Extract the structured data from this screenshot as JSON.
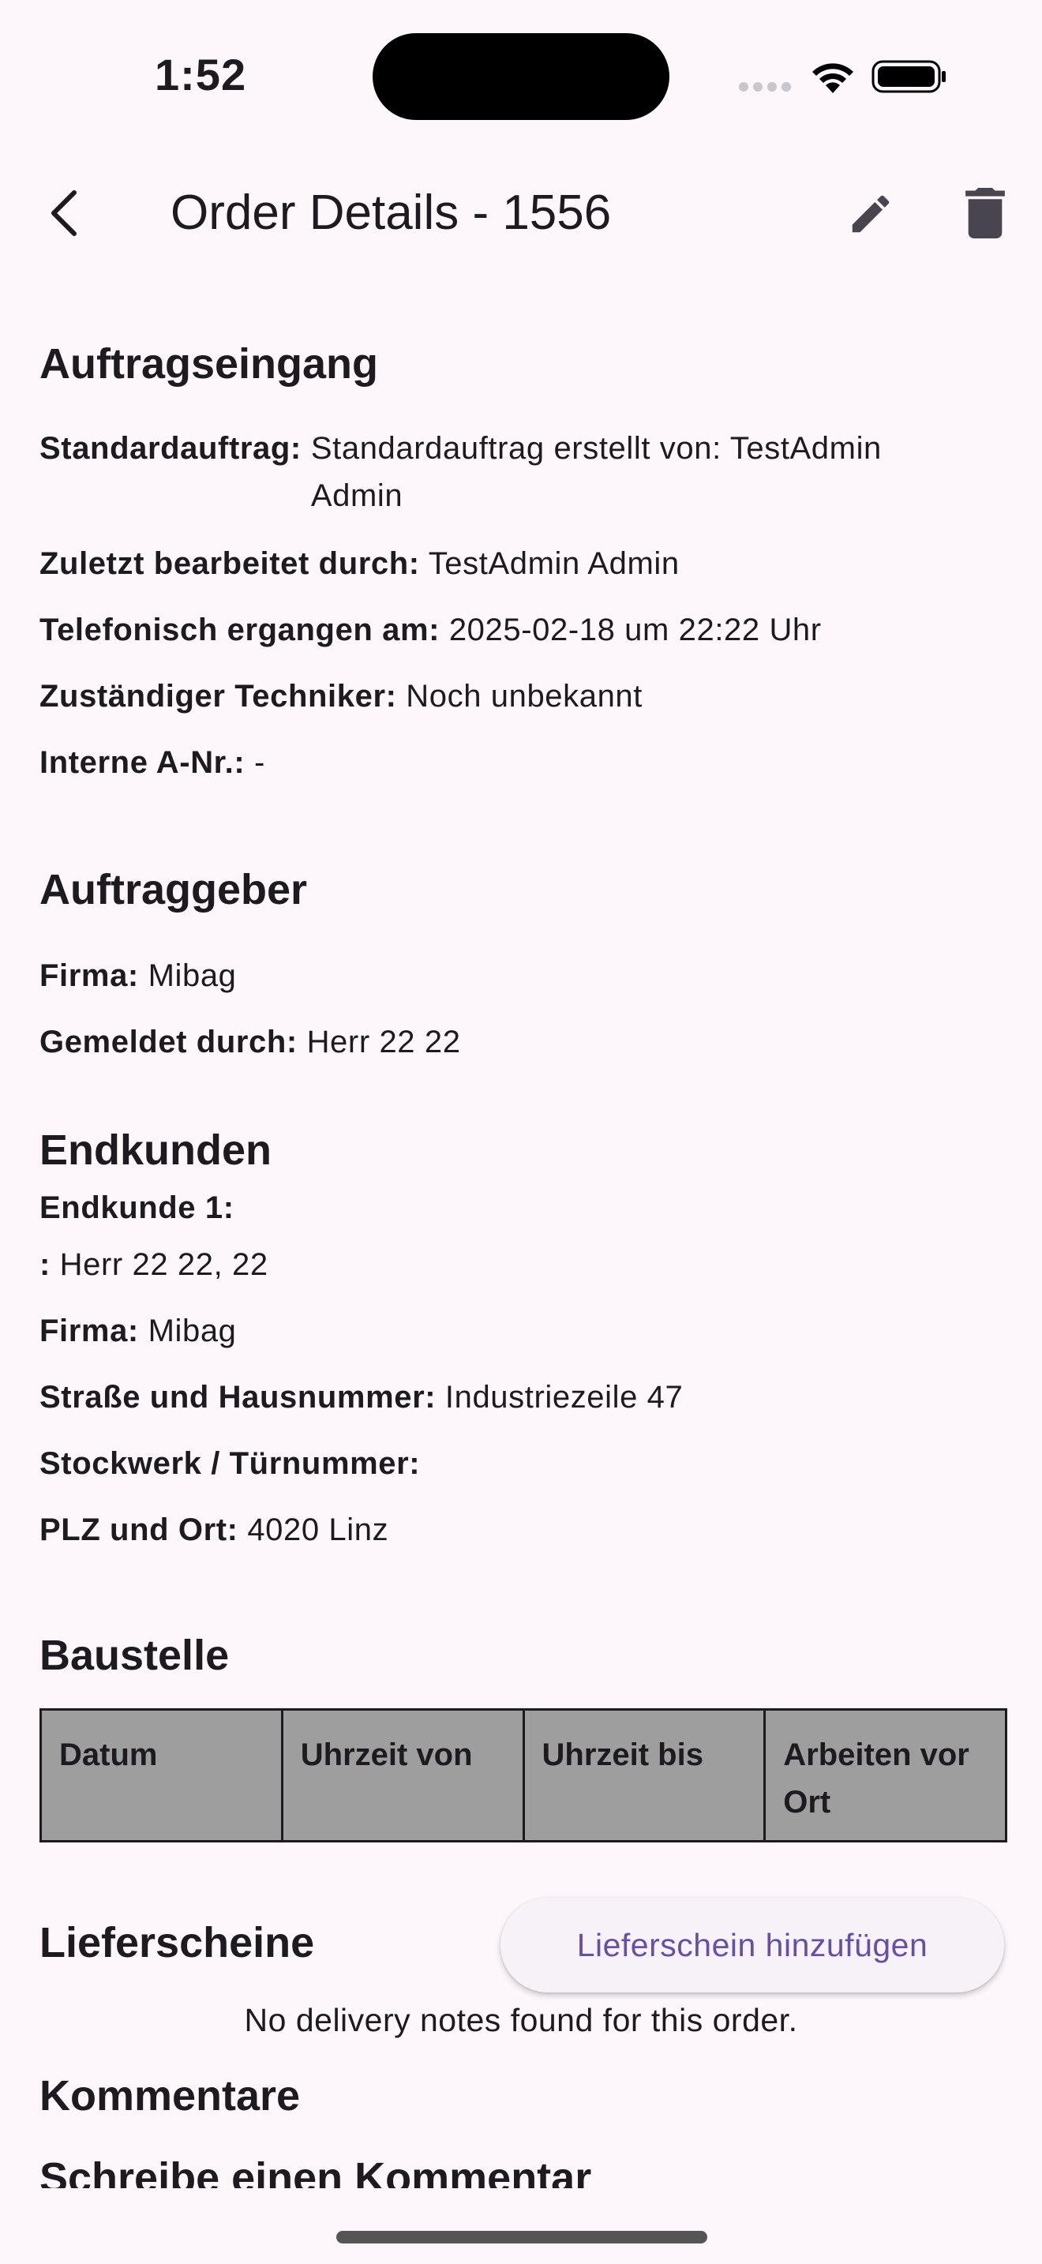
{
  "status_bar": {
    "time": "1:52"
  },
  "app_bar": {
    "title": "Order Details - 1556"
  },
  "auftragseingang": {
    "title": "Auftragseingang",
    "standardauftrag_label": "Standardauftrag:",
    "standardauftrag_value": "Standardauftrag erstellt von: TestAdmin Admin",
    "bearbeitet_label": "Zuletzt bearbeitet durch:",
    "bearbeitet_value": "TestAdmin Admin",
    "telefonisch_label": "Telefonisch ergangen am:",
    "telefonisch_value": "2025-02-18 um 22:22 Uhr",
    "techniker_label": "Zuständiger Techniker:",
    "techniker_value": "Noch unbekannt",
    "interne_label": "Interne A-Nr.:",
    "interne_value": "-"
  },
  "auftraggeber": {
    "title": "Auftraggeber",
    "firma_label": "Firma:",
    "firma_value": "Mibag",
    "gemeldet_label": "Gemeldet durch:",
    "gemeldet_value": "Herr 22 22"
  },
  "endkunden": {
    "title": "Endkunden",
    "endkunde_label": "Endkunde 1:",
    "name_label": ":",
    "name_value": "Herr 22 22, 22",
    "firma_label": "Firma:",
    "firma_value": "Mibag",
    "strasse_label": "Straße und Hausnummer:",
    "strasse_value": "Industriezeile 47",
    "stockwerk_label": "Stockwerk / Türnummer:",
    "stockwerk_value": "",
    "plz_label": "PLZ und Ort:",
    "plz_value": "4020 Linz"
  },
  "baustelle": {
    "title": "Baustelle",
    "columns": [
      "Datum",
      "Uhrzeit von",
      "Uhrzeit bis",
      "Arbeiten vor Ort"
    ]
  },
  "lieferscheine": {
    "title": "Lieferscheine",
    "add_button": "Lieferschein hinzufügen",
    "empty": "No delivery notes found for this order."
  },
  "kommentare": {
    "title": "Kommentare",
    "write_comment": "Schreibe einen Kommentar"
  }
}
